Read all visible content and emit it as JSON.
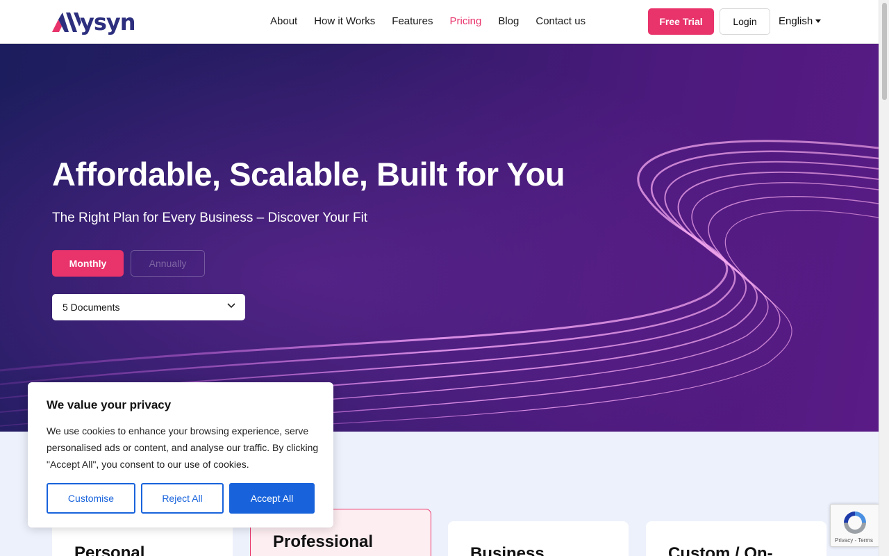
{
  "header": {
    "logo_text": "ysyn",
    "nav": [
      "About",
      "How it Works",
      "Features",
      "Pricing",
      "Blog",
      "Contact us"
    ],
    "active_nav": "Pricing",
    "free_trial": "Free Trial",
    "login": "Login",
    "language": "English"
  },
  "hero": {
    "title": "Affordable, Scalable, Built for You",
    "subtitle": "The Right Plan for Every Business – Discover Your Fit",
    "billing_monthly": "Monthly",
    "billing_annually": "Annually",
    "documents_selected": "5 Documents"
  },
  "plans": [
    {
      "title": "Personal"
    },
    {
      "title": "Professional"
    },
    {
      "title": "Business"
    },
    {
      "title": "Custom / On-"
    }
  ],
  "cookie": {
    "title": "We value your privacy",
    "text": "We use cookies to enhance your browsing experience, serve personalised ads or content, and analyse our traffic. By clicking \"Accept All\", you consent to our use of cookies.",
    "customise": "Customise",
    "reject": "Reject All",
    "accept": "Accept All"
  },
  "recaptcha": {
    "links": "Privacy - Terms"
  },
  "colors": {
    "brand_pink": "#e8336b",
    "brand_navy": "#2d2f7e",
    "cookie_blue": "#1863dc"
  }
}
